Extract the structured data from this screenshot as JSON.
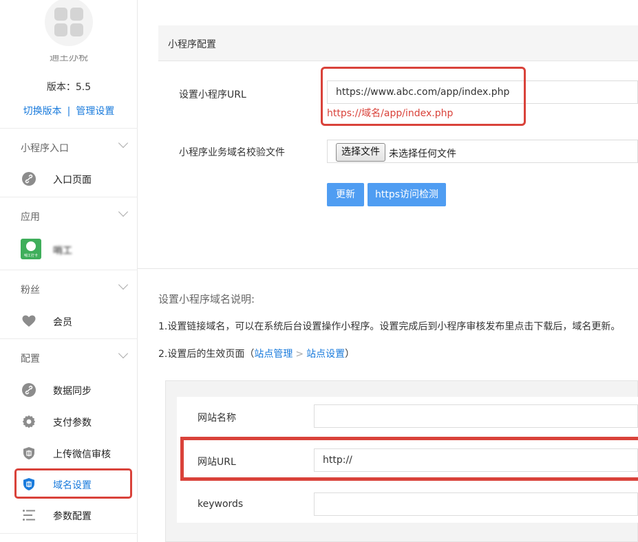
{
  "sidebar": {
    "app_name": "通王办税",
    "version_label": "版本：5.5",
    "switch_version": "切换版本",
    "separator": "|",
    "manage_settings": "管理设置",
    "groups": [
      {
        "title": "小程序入口",
        "items": [
          {
            "label": "入口页面",
            "icon": "link-icon"
          }
        ]
      },
      {
        "title": "应用",
        "items": [
          {
            "label": "哨工",
            "icon": "app-thumbnail"
          }
        ]
      },
      {
        "title": "粉丝",
        "items": [
          {
            "label": "会员",
            "icon": "heart-icon"
          }
        ]
      },
      {
        "title": "配置",
        "items": [
          {
            "label": "数据同步",
            "icon": "link-icon"
          },
          {
            "label": "支付参数",
            "icon": "gear-icon"
          },
          {
            "label": "上传微信审核",
            "icon": "shield-icon"
          },
          {
            "label": "域名设置",
            "icon": "shield-icon",
            "active": true
          },
          {
            "label": "参数配置",
            "icon": "list-icon"
          }
        ]
      }
    ],
    "app_thumb_caption": "哨工打卡"
  },
  "panel": {
    "title": "小程序配置",
    "url_label": "设置小程序URL",
    "url_value": "https://www.abc.com/app/index.php",
    "url_hint": "https://域名/app/index.php",
    "file_label": "小程序业务域名校验文件",
    "file_button": "选择文件",
    "file_none": "未选择任何文件",
    "update_button": "更新",
    "check_button": "https访问检测"
  },
  "notes": {
    "title": "设置小程序域名说明:",
    "line1": "1.设置链接域名，可以在系统后台设置操作小程序。设置完成后到小程序审核发布里点击下载后，域名更新。",
    "line2_prefix": "2.设置后的生效页面（",
    "line2_link1": "站点管理",
    "line2_sep": ">",
    "line2_link2": "站点设置",
    "line2_suffix": "）"
  },
  "example": {
    "site_name_label": "网站名称",
    "site_name_value": "",
    "site_url_label": "网站URL",
    "site_url_value": "http://",
    "keywords_label": "keywords",
    "keywords_value": ""
  },
  "colors": {
    "accent": "#1a7bdc",
    "highlight": "#d9423a",
    "button": "#4f9df2"
  }
}
